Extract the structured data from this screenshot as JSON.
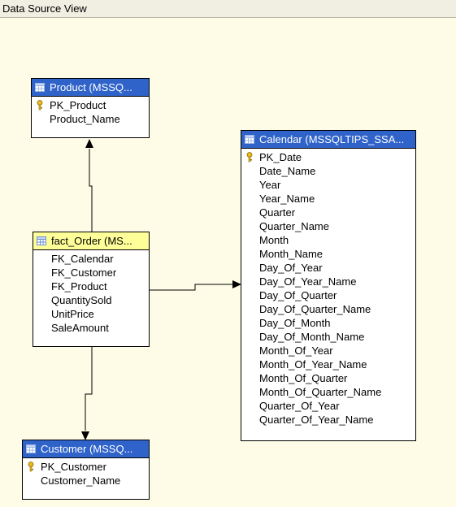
{
  "window": {
    "title": "Data Source View"
  },
  "tables": {
    "product": {
      "header": "Product (MSSQ...",
      "columns": [
        {
          "name": "PK_Product",
          "key": true
        },
        {
          "name": "Product_Name",
          "key": false
        }
      ]
    },
    "calendar": {
      "header": "Calendar (MSSQLTIPS_SSA...",
      "columns": [
        {
          "name": "PK_Date",
          "key": true
        },
        {
          "name": "Date_Name",
          "key": false
        },
        {
          "name": "Year",
          "key": false
        },
        {
          "name": "Year_Name",
          "key": false
        },
        {
          "name": "Quarter",
          "key": false
        },
        {
          "name": "Quarter_Name",
          "key": false
        },
        {
          "name": "Month",
          "key": false
        },
        {
          "name": "Month_Name",
          "key": false
        },
        {
          "name": "Day_Of_Year",
          "key": false
        },
        {
          "name": "Day_Of_Year_Name",
          "key": false
        },
        {
          "name": "Day_Of_Quarter",
          "key": false
        },
        {
          "name": "Day_Of_Quarter_Name",
          "key": false
        },
        {
          "name": "Day_Of_Month",
          "key": false
        },
        {
          "name": "Day_Of_Month_Name",
          "key": false
        },
        {
          "name": "Month_Of_Year",
          "key": false
        },
        {
          "name": "Month_Of_Year_Name",
          "key": false
        },
        {
          "name": "Month_Of_Quarter",
          "key": false
        },
        {
          "name": "Month_Of_Quarter_Name",
          "key": false
        },
        {
          "name": "Quarter_Of_Year",
          "key": false
        },
        {
          "name": "Quarter_Of_Year_Name",
          "key": false
        }
      ]
    },
    "fact_order": {
      "header": "fact_Order (MS...",
      "columns": [
        {
          "name": "FK_Calendar",
          "key": false
        },
        {
          "name": "FK_Customer",
          "key": false
        },
        {
          "name": "FK_Product",
          "key": false
        },
        {
          "name": "QuantitySold",
          "key": false
        },
        {
          "name": "UnitPrice",
          "key": false
        },
        {
          "name": "SaleAmount",
          "key": false
        }
      ]
    },
    "customer": {
      "header": "Customer (MSSQ...",
      "columns": [
        {
          "name": "PK_Customer",
          "key": true
        },
        {
          "name": "Customer_Name",
          "key": false
        }
      ]
    }
  },
  "colors": {
    "canvas": "#fefbe6",
    "dimension_header": "#2f63c9",
    "fact_header": "#ffff99",
    "key_icon": "#d4a017"
  }
}
